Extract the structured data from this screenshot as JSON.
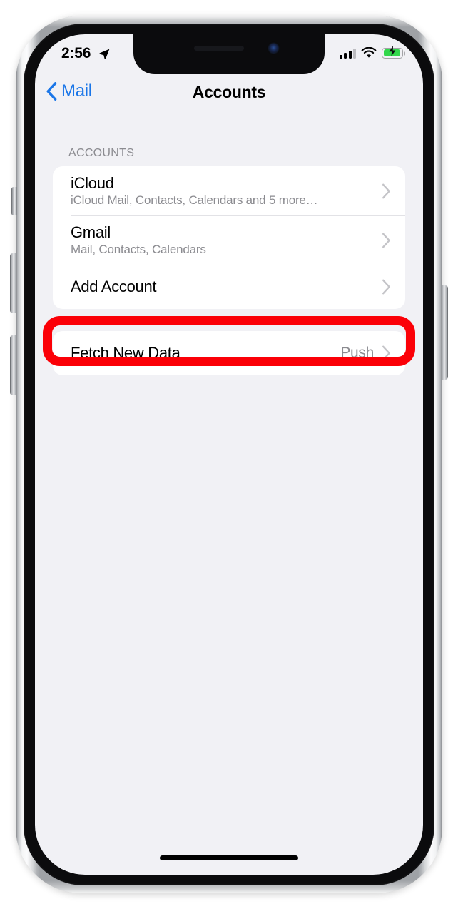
{
  "device": {
    "frame_color": "#9fa2a6",
    "bezel_color": "#0b0b0d",
    "screen_bg": "#f1f1f5",
    "buttons": [
      {
        "name": "mute-switch"
      },
      {
        "name": "volume-up-button"
      },
      {
        "name": "volume-down-button"
      },
      {
        "name": "power-button"
      }
    ]
  },
  "status_bar": {
    "time": "2:56",
    "location_icon": "location-arrow-icon",
    "cellular_icon": "cellular-bars-icon",
    "cellular_bars_filled": 3,
    "cellular_bars_total": 4,
    "wifi_icon": "wifi-icon",
    "battery_icon": "battery-charging-icon",
    "battery_charging": true,
    "battery_level_percent": 80,
    "battery_color": "#32d74b"
  },
  "nav_bar": {
    "back_icon": "chevron-left-icon",
    "back_label": "Mail",
    "title": "Accounts",
    "tint_color": "#1a76e8"
  },
  "sections": [
    {
      "header": "ACCOUNTS",
      "rows": [
        {
          "title": "iCloud",
          "subtitle": "iCloud Mail, Contacts, Calendars and 5 more…",
          "value": "",
          "accessory": "chevron-right-icon",
          "highlighted": false
        },
        {
          "title": "Gmail",
          "subtitle": "Mail, Contacts, Calendars",
          "value": "",
          "accessory": "chevron-right-icon",
          "highlighted": false
        },
        {
          "title": "Add Account",
          "subtitle": "",
          "value": "",
          "accessory": "chevron-right-icon",
          "highlighted": true
        }
      ]
    },
    {
      "header": "",
      "rows": [
        {
          "title": "Fetch New Data",
          "subtitle": "",
          "value": "Push",
          "accessory": "chevron-right-icon",
          "highlighted": false
        }
      ]
    }
  ],
  "annotation": {
    "target": "Add Account",
    "shape": "rounded-rectangle-outline",
    "color": "#fb0007",
    "stroke_width_px": 13
  },
  "home_indicator": {
    "name": "home-indicator"
  }
}
